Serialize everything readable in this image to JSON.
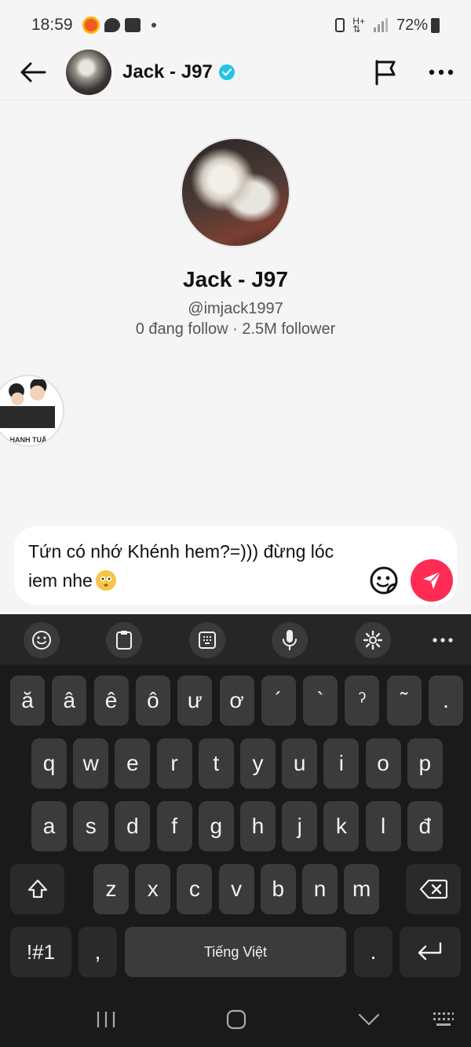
{
  "status_bar": {
    "time": "18:59",
    "battery": "72%"
  },
  "header": {
    "name": "Jack - J97"
  },
  "profile": {
    "name": "Jack - J97",
    "handle": "@imjack1997",
    "stats": "0 đang follow · 2.5M follower"
  },
  "sender": {
    "avatar_caption": "HANH TUẤ"
  },
  "composer": {
    "text": "Tứn có nhớ Khénh hem?=))) đừng lóc iem nhe"
  },
  "keyboard": {
    "row_accents": [
      "ă",
      "â",
      "ê",
      "ô",
      "ư",
      "ơ",
      "´",
      "`",
      "ˀ",
      "˜",
      "."
    ],
    "row1": [
      "q",
      "w",
      "e",
      "r",
      "t",
      "y",
      "u",
      "i",
      "o",
      "p"
    ],
    "row2": [
      "a",
      "s",
      "d",
      "f",
      "g",
      "h",
      "j",
      "k",
      "l",
      "đ"
    ],
    "row3": [
      "z",
      "x",
      "c",
      "v",
      "b",
      "n",
      "m"
    ],
    "symbols_label": "!#1",
    "comma_label": ",",
    "space_label": "Tiếng Việt",
    "period_label": "."
  },
  "colors": {
    "send": "#fe2c55",
    "verified": "#20c5e8",
    "keyboard_bg": "#1a1a1a",
    "key_bg": "#3b3b3b"
  }
}
